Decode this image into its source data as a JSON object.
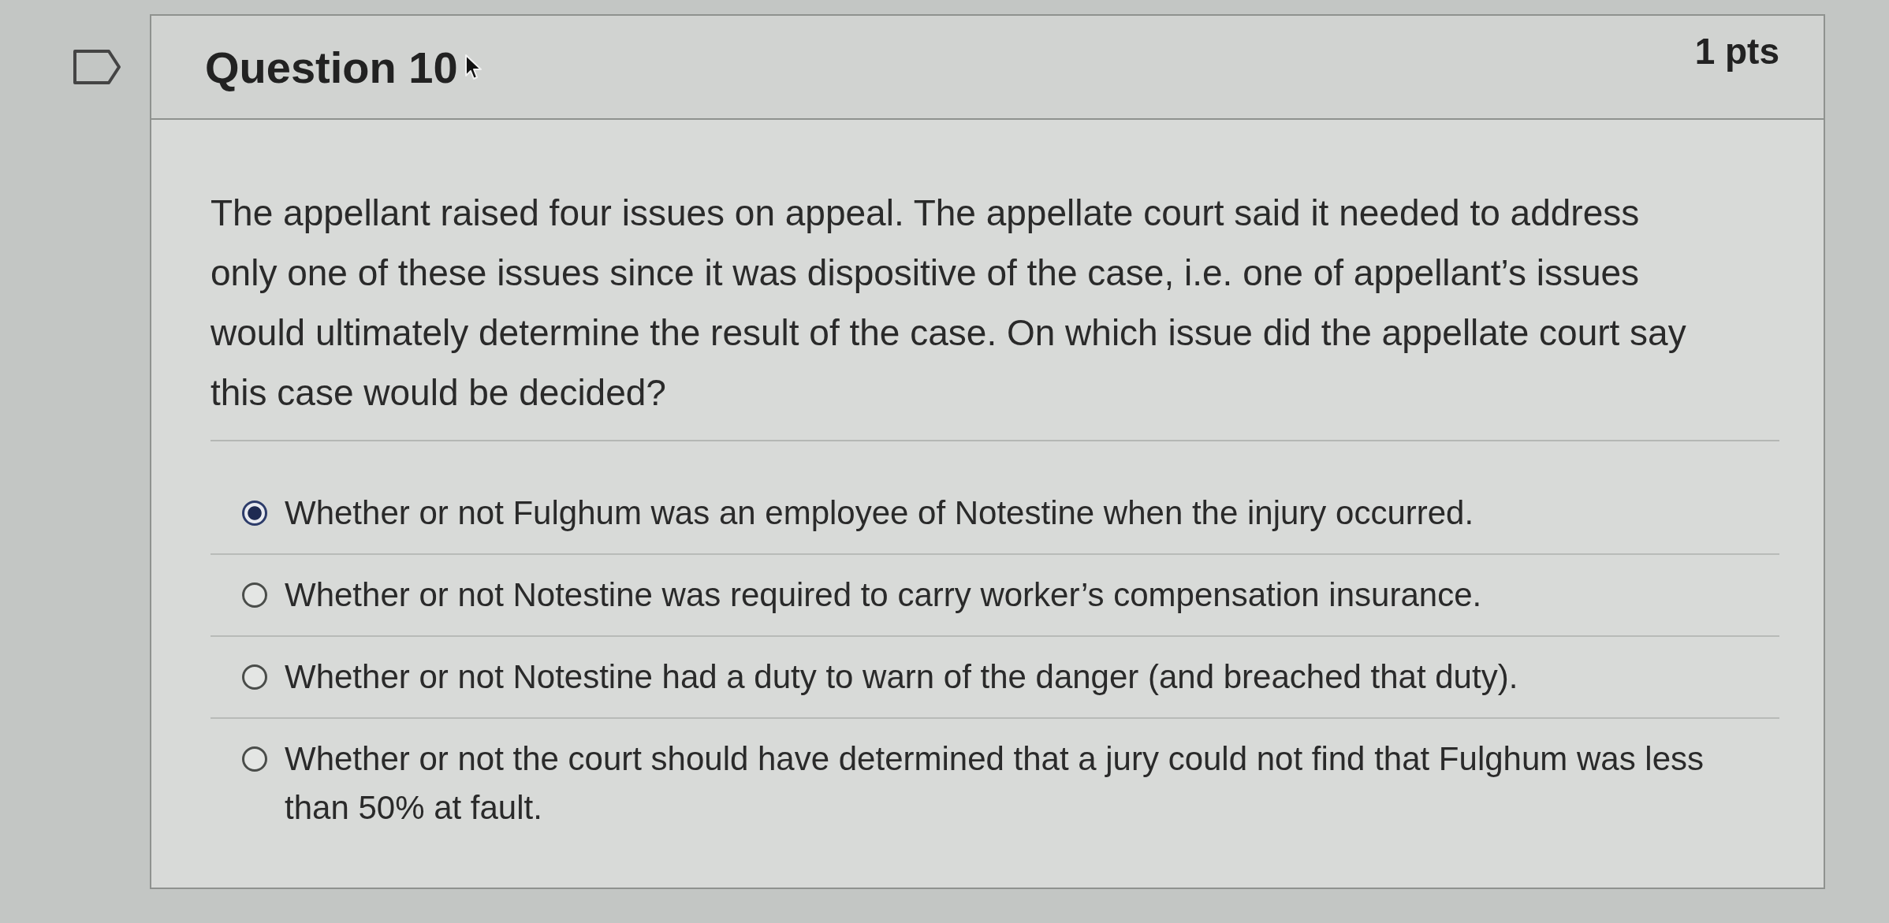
{
  "question": {
    "title": "Question 10",
    "points": "1 pts",
    "flagged": false,
    "text": "The appellant raised four issues on appeal. The appellate court said it needed to address only one of these issues since it was dispositive of the case, i.e. one of appellant’s issues would ultimately determine the result of the case. On which issue did the appellate court say this case would be decided?",
    "answers": [
      {
        "text": "Whether or not Fulghum was an employee of Notestine when the injury occurred.",
        "selected": true
      },
      {
        "text": "Whether or not Notestine was required to carry worker’s compensation insurance.",
        "selected": false
      },
      {
        "text": "Whether or not Notestine had a duty to warn of the danger (and breached that duty).",
        "selected": false
      },
      {
        "text": "Whether or not the court should have determined that a jury could not find that Fulghum was less than 50% at fault.",
        "selected": false
      }
    ]
  }
}
